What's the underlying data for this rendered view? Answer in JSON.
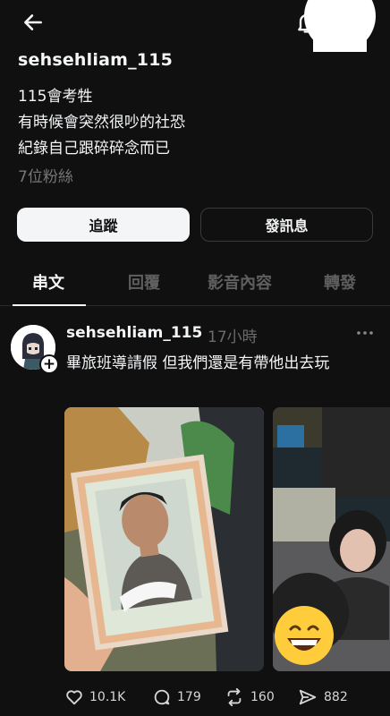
{
  "topbar": {
    "back_icon": "arrow-left-icon",
    "bell_icon": "bell-icon",
    "more_icon": "more-circle-icon"
  },
  "profile": {
    "username": "sehsehliam_115",
    "bio_lines": [
      "115會考牲",
      "有時候會突然很吵的社恐",
      "紀錄自己跟碎碎念而已"
    ],
    "followers": "7位粉絲"
  },
  "buttons": {
    "follow": "追蹤",
    "message": "發訊息"
  },
  "tabs": [
    {
      "label": "串文",
      "active": true
    },
    {
      "label": "回覆",
      "active": false
    },
    {
      "label": "影音內容",
      "active": false
    },
    {
      "label": "轉發",
      "active": false
    }
  ],
  "post": {
    "username": "sehsehliam_115",
    "time": "17小時",
    "text": "畢旅班導請假 但我們還是有帶他出去玩",
    "likes": "10.1K",
    "comments": "179",
    "reposts": "160",
    "shares": "882"
  },
  "colors": {
    "background": "#101010",
    "text": "#f3f5f7",
    "muted": "#777777"
  }
}
